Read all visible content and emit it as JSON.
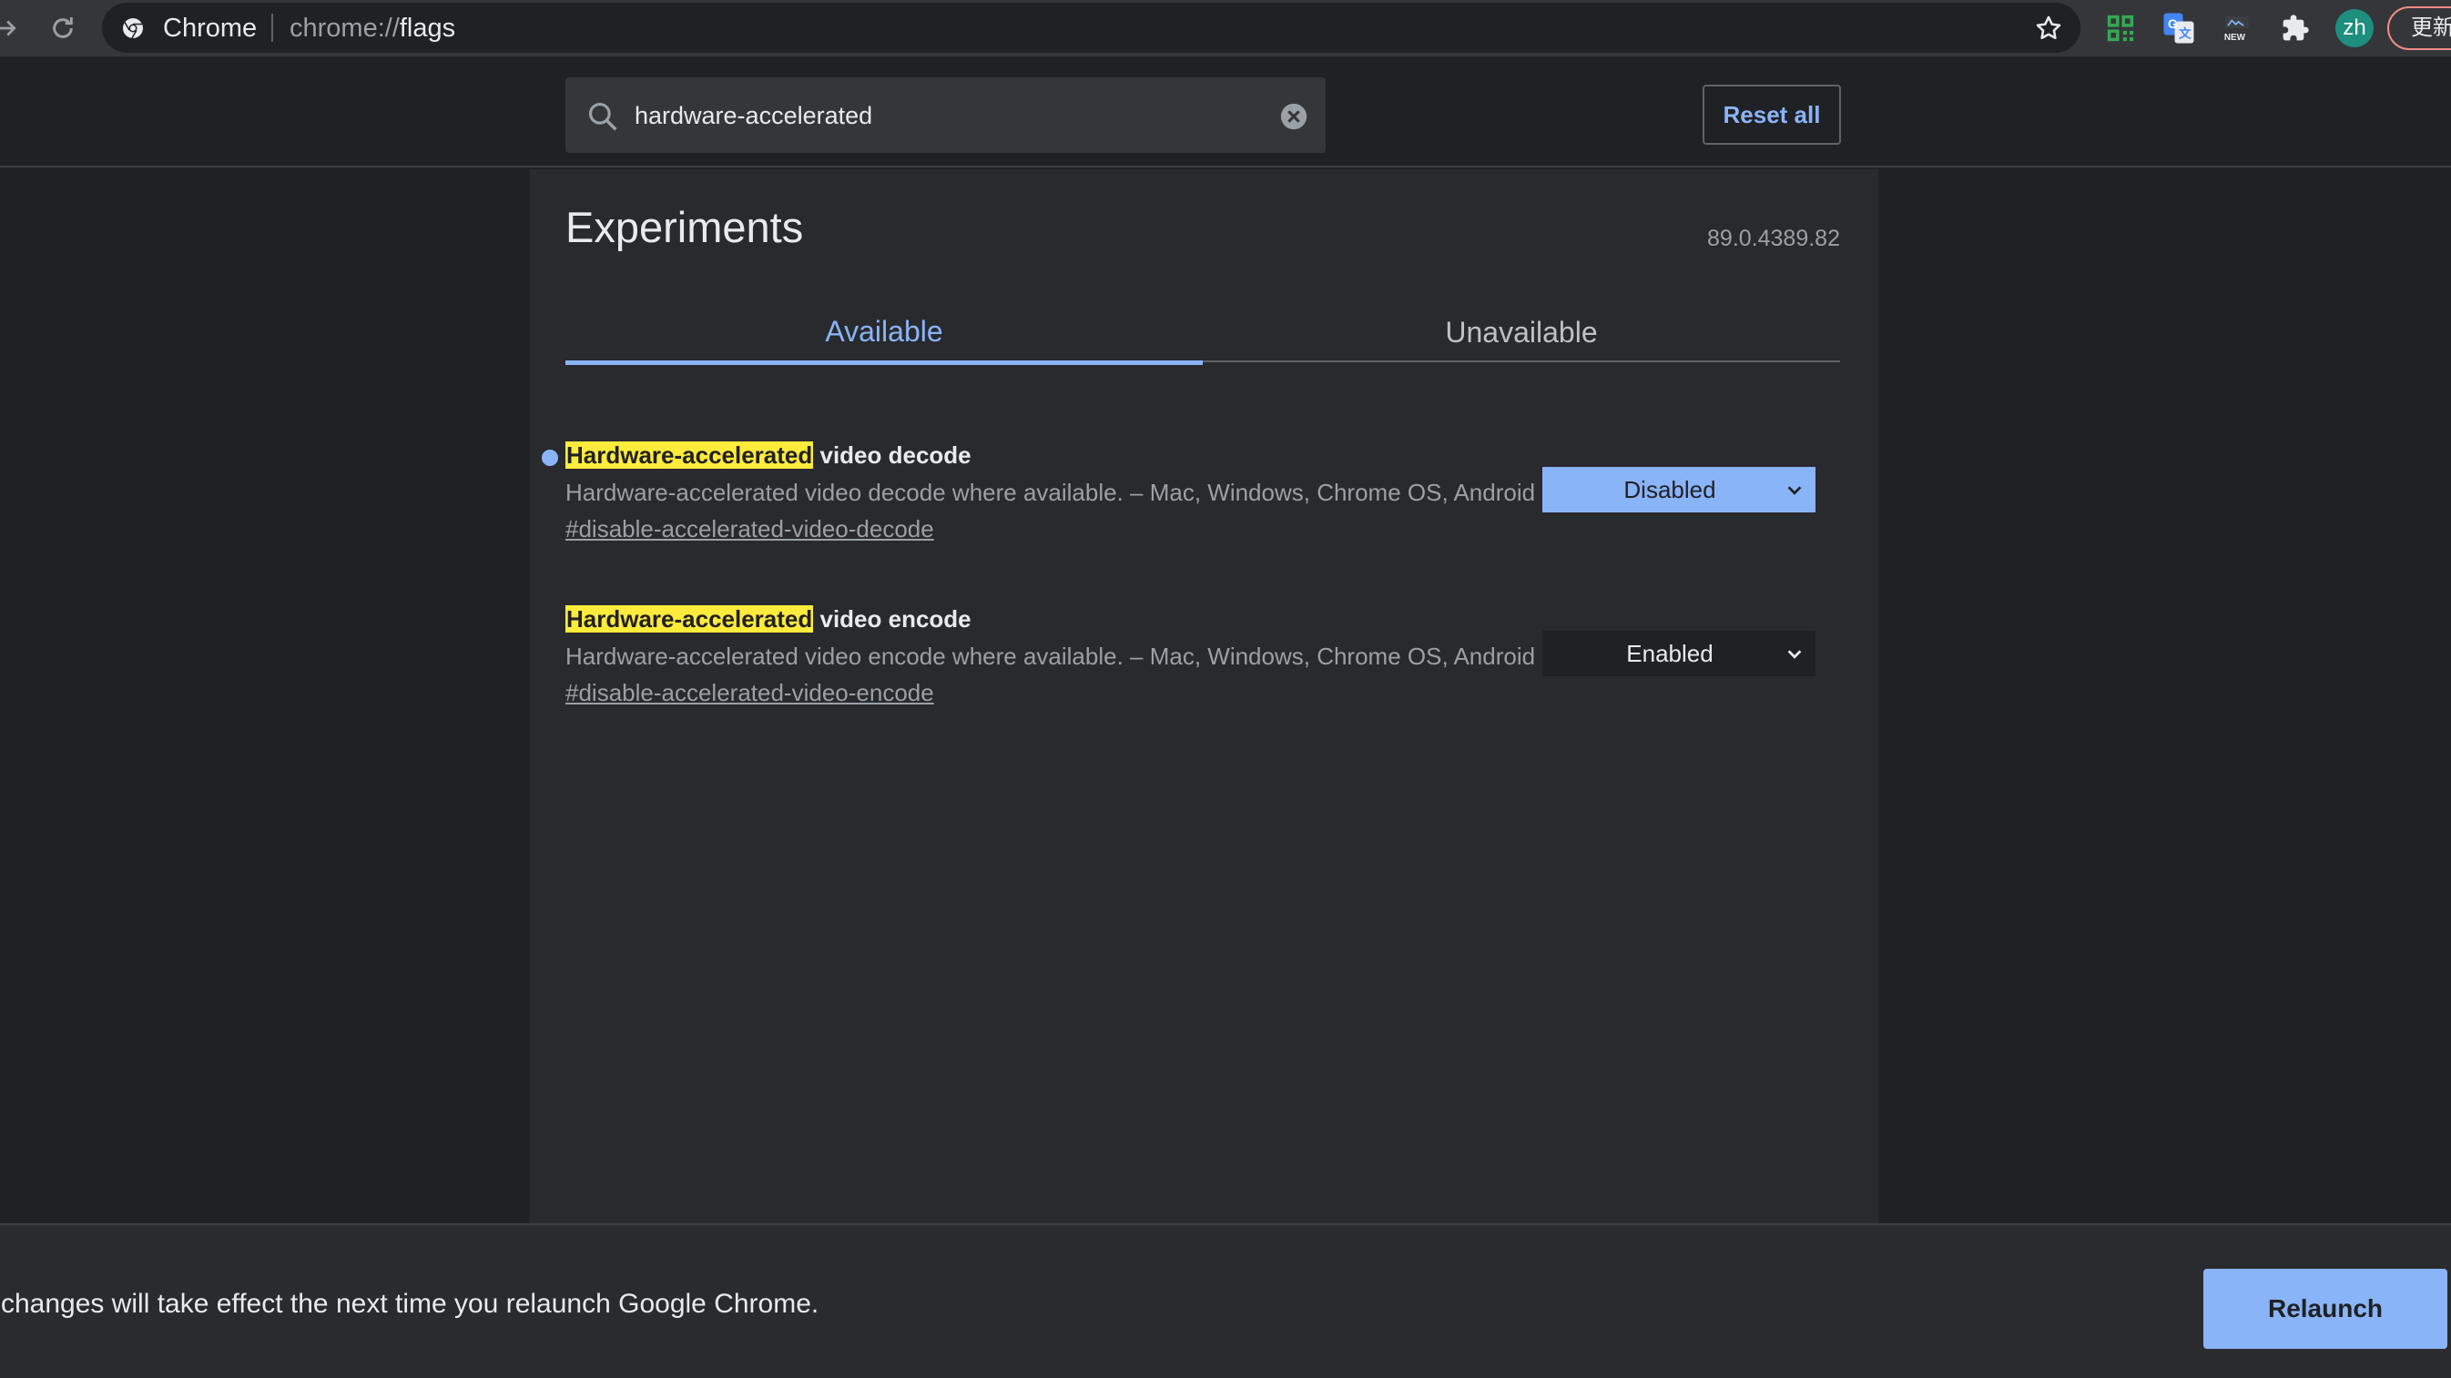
{
  "toolbar": {
    "site_chip": "Chrome",
    "url_scheme": "chrome://",
    "url_host": "flags",
    "avatar_initials": "zh",
    "update_label": "更新"
  },
  "header": {
    "search_value": "hardware-accelerated",
    "reset_label": "Reset all"
  },
  "main": {
    "title": "Experiments",
    "version": "89.0.4389.82",
    "tabs": [
      {
        "label": "Available"
      },
      {
        "label": "Unavailable"
      }
    ],
    "experiments": [
      {
        "highlight": "Hardware-accelerated",
        "title_rest": " video decode",
        "description": "Hardware-accelerated video decode where available. – Mac, Windows, Chrome OS, Android",
        "link": "#disable-accelerated-video-decode",
        "value": "Disabled",
        "modified": true
      },
      {
        "highlight": "Hardware-accelerated",
        "title_rest": " video encode",
        "description": "Hardware-accelerated video encode where available. – Mac, Windows, Chrome OS, Android",
        "link": "#disable-accelerated-video-encode",
        "value": "Enabled",
        "modified": false
      }
    ]
  },
  "footer": {
    "message": "Your changes will take effect the next time you relaunch Google Chrome.",
    "relaunch_label": "Relaunch"
  },
  "colors": {
    "accent": "#8ab4f8",
    "highlight": "#ffeb3b",
    "background": "#202124"
  }
}
